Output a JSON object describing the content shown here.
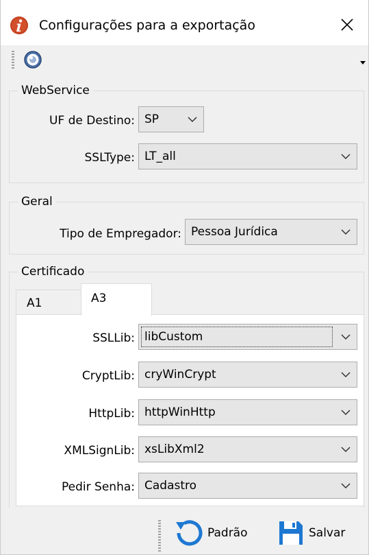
{
  "window": {
    "title": "Configurações para a exportação",
    "icon": "info-circle-icon",
    "close_icon": "close-icon"
  },
  "toolbar": {
    "help_icon": "help-icon",
    "overflow_icon": "dropdown-arrow-icon"
  },
  "webservice": {
    "legend": "WebService",
    "uf_label": "UF de Destino:",
    "uf_value": "SP",
    "ssltype_label": "SSLType:",
    "ssltype_value": "LT_all"
  },
  "geral": {
    "legend": "Geral",
    "tipo_label": "Tipo de Empregador:",
    "tipo_value": "Pessoa Jurídica"
  },
  "certificado": {
    "legend": "Certificado",
    "tabs": [
      {
        "label": "A1",
        "active": false
      },
      {
        "label": "A3",
        "active": true
      }
    ],
    "fields": [
      {
        "label": "SSLLib:",
        "value": "libCustom"
      },
      {
        "label": "CryptLib:",
        "value": "cryWinCrypt"
      },
      {
        "label": "HttpLib:",
        "value": "httpWinHttp"
      },
      {
        "label": "XMLSignLib:",
        "value": "xsLibXml2"
      },
      {
        "label": "Pedir Senha:",
        "value": "Cadastro"
      }
    ]
  },
  "footer": {
    "padrao_label": "Padrão",
    "padrao_icon": "reset-icon",
    "salvar_label": "Salvar",
    "salvar_icon": "save-icon"
  },
  "colors": {
    "app_icon_red": "#c3401f",
    "accent_blue": "#1e78d2",
    "combo_bg": "#e6e6e6",
    "window_bg": "#f0f0f0"
  }
}
